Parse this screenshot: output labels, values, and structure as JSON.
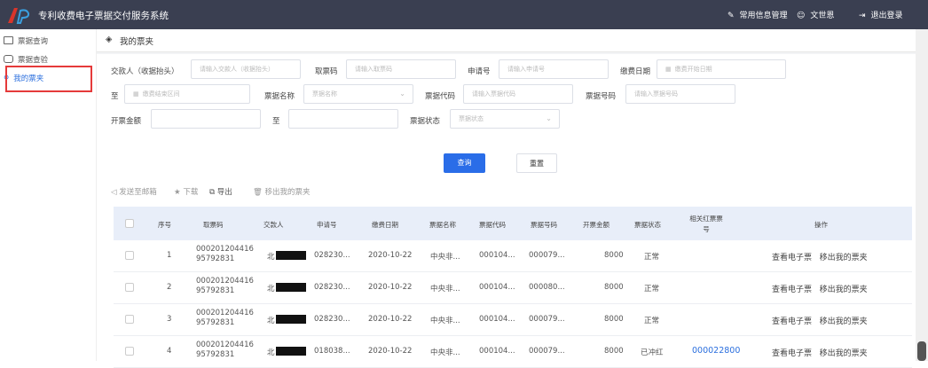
{
  "app": {
    "title": "专利收费电子票据交付服务系统"
  },
  "top_actions": {
    "common_info": "常用信息管理",
    "user": "文世恩",
    "logout": "退出登录"
  },
  "sidebar": {
    "items": [
      {
        "label": "票据查询"
      },
      {
        "label": "票据查验"
      },
      {
        "label": "我的票夹"
      }
    ]
  },
  "breadcrumb": {
    "title": "我的票夹"
  },
  "filters": {
    "payer_label": "交款人（收据抬头）",
    "payer_placeholder": "请输入交款人（收据抬头）",
    "pickup_label": "取票码",
    "pickup_placeholder": "请输入取票码",
    "app_no_label": "申请号",
    "app_no_placeholder": "请输入申请号",
    "pay_date_label": "缴费日期",
    "pay_date_placeholder": "缴费开始日期",
    "to_label": "至",
    "pay_end_placeholder": "缴费结束区间",
    "bill_name_label": "票据名称",
    "bill_name_placeholder": "票据名称",
    "bill_code_label": "票据代码",
    "bill_code_placeholder": "请输入票据代码",
    "bill_no_label": "票据号码",
    "bill_no_placeholder": "请输入票据号码",
    "amount_label": "开票金额",
    "amount_to_label": "至",
    "status_label": "票据状态",
    "status_placeholder": "票据状态",
    "query": "查询",
    "reset": "重置"
  },
  "toolbar": {
    "send_email": "发送至邮箱",
    "download": "下载",
    "export": "导出",
    "remove": "移出我的票夹"
  },
  "table": {
    "columns": [
      "序号",
      "取票码",
      "交款人",
      "申请号",
      "缴费日期",
      "票据名称",
      "票据代码",
      "票据号码",
      "开票金额",
      "票据状态",
      "相关红票票号",
      "操作"
    ],
    "rows": [
      {
        "index": "1",
        "pickup": "00020120441695792831",
        "payer": "北",
        "app_no": "028230...",
        "date": "2020-10-22",
        "name": "中央非...",
        "code": "000104...",
        "number": "000079...",
        "amount": "8000",
        "status": "正常",
        "red": ""
      },
      {
        "index": "2",
        "pickup": "00020120441695792831",
        "payer": "北",
        "app_no": "028230...",
        "date": "2020-10-22",
        "name": "中央非...",
        "code": "000104...",
        "number": "000080...",
        "amount": "8000",
        "status": "正常",
        "red": ""
      },
      {
        "index": "3",
        "pickup": "00020120441695792831",
        "payer": "北",
        "app_no": "028230...",
        "date": "2020-10-22",
        "name": "中央非...",
        "code": "000104...",
        "number": "000079...",
        "amount": "8000",
        "status": "正常",
        "red": ""
      },
      {
        "index": "4",
        "pickup": "00020120441695792831",
        "payer": "北",
        "app_no": "018038...",
        "date": "2020-10-22",
        "name": "中央非...",
        "code": "000104...",
        "number": "000079...",
        "amount": "8000",
        "status": "已冲红",
        "red": "000022800"
      }
    ],
    "op_view": "查看电子票",
    "op_remove": "移出我的票夹"
  },
  "colors": {
    "topbar": "#3a3f51",
    "primary": "#2a6de8",
    "highlight_box": "#e53a3a",
    "header_bg": "#e8eef9"
  }
}
